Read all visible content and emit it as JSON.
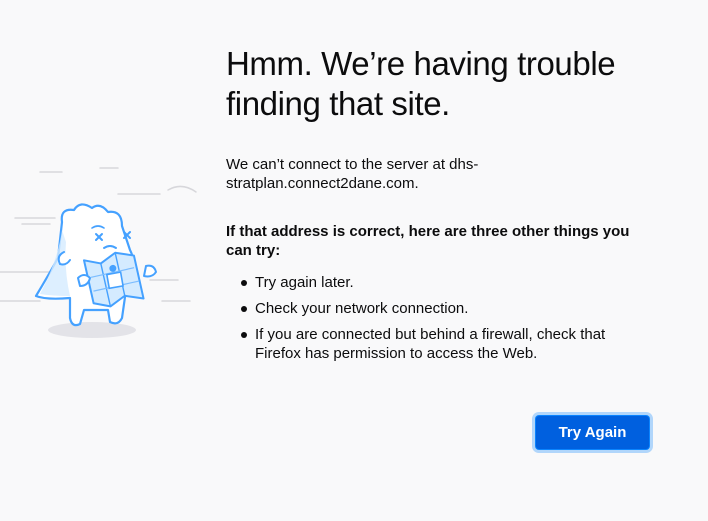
{
  "error_page": {
    "title": "Hmm. We’re having trouble finding that site.",
    "description": "We can’t connect to the server at dhs-stratplan.connect2dane.com.",
    "subheading": "If that address is correct, here are three other things you can try:",
    "tips": [
      "Try again later.",
      "Check your network connection.",
      "If you are connected but behind a firewall, check that Firefox has permission to access the Web."
    ],
    "button_label": "Try Again",
    "illustration_icon": "confused-creature-with-map-icon"
  },
  "colors": {
    "background": "#f9f9fa",
    "text": "#0c0c0d",
    "button": "#0060df",
    "button_text": "#ffffff",
    "illustration_stroke": "#45a1ff",
    "illustration_fill": "#d4ebff"
  }
}
